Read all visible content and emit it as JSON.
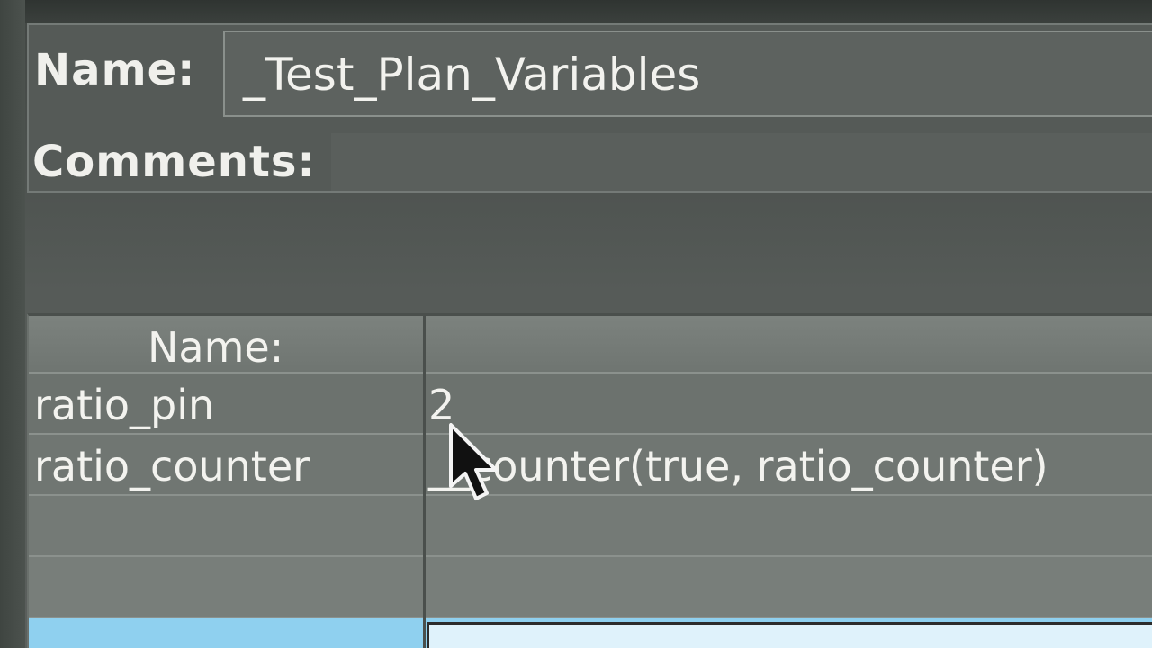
{
  "form": {
    "name_label": "Name:",
    "name_value": "_Test_Plan_Variables",
    "comments_label": "Comments:",
    "comments_value": ""
  },
  "variables_table": {
    "columns": [
      "Name:",
      ""
    ],
    "rows": [
      {
        "name": "ratio_pin",
        "value": "2"
      },
      {
        "name": "ratio_counter",
        "value": "__counter(true, ratio_counter)"
      },
      {
        "name": "",
        "value": ""
      },
      {
        "name": "",
        "value": ""
      },
      {
        "name": "",
        "value": ""
      }
    ]
  },
  "colors": {
    "selection": "#8fd0ef",
    "text": "#f3f3ef"
  },
  "icons": {
    "cursor": "mouse-pointer-icon"
  }
}
